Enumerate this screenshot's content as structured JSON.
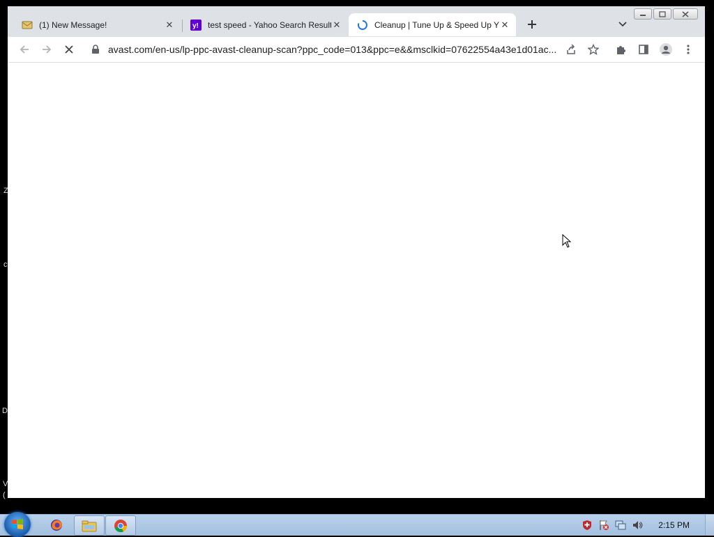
{
  "browser": {
    "tabs": [
      {
        "title": "(1) New Message!",
        "active": false,
        "favicon": "mail-icon"
      },
      {
        "title": "test speed - Yahoo Search Results",
        "active": false,
        "favicon": "yahoo-icon"
      },
      {
        "title": "Cleanup | Tune Up & Speed Up Y",
        "active": true,
        "favicon": "loading-spinner-icon"
      }
    ],
    "url": "avast.com/en-us/lp-ppc-avast-cleanup-scan?ppc_code=013&ppc=e&&msclkid=07622554a43e1d01ac..."
  },
  "desktop": {
    "fragments": [
      "Z",
      "c",
      "D",
      "V",
      "("
    ]
  },
  "taskbar": {
    "clock": "2:15 PM",
    "apps": [
      "firefox-icon",
      "file-explorer-icon",
      "chrome-icon"
    ]
  },
  "colors": {
    "tabstrip_bg": "#dee1e6",
    "active_tab_bg": "#ffffff",
    "spinner": "#1a73e8",
    "yahoo_purple": "#6001d2",
    "taskbar": "#b9d1ea"
  }
}
